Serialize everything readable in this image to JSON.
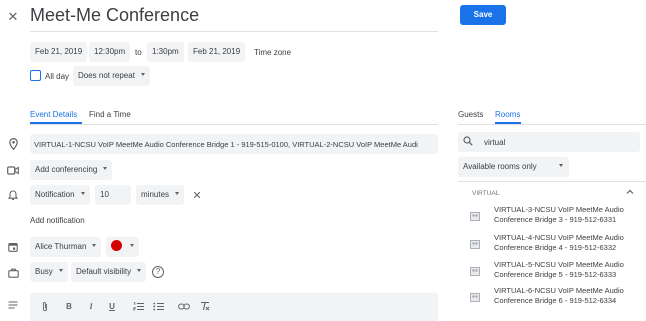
{
  "header": {
    "title": "Meet-Me Conference",
    "save_label": "Save"
  },
  "datetime": {
    "start_date": "Feb 21, 2019",
    "start_time": "12:30pm",
    "to_label": "to",
    "end_time": "1:30pm",
    "end_date": "Feb 21, 2019",
    "timezone_label": "Time zone",
    "allday_label": "All day",
    "repeat_value": "Does not repeat"
  },
  "tabs": {
    "event_details": "Event Details",
    "find_time": "Find a Time"
  },
  "details": {
    "location_value": "VIRTUAL-1-NCSU VoIP MeetMe Audio Conference Bridge 1 - 919-515-0100, VIRTUAL-2-NCSU VoIP MeetMe Audi",
    "conferencing_label": "Add conferencing",
    "notification_type": "Notification",
    "notification_amount": "10",
    "notification_unit": "minutes",
    "add_notification": "Add notification",
    "calendar_owner": "Alice Thurman",
    "busy_value": "Busy",
    "visibility_value": "Default visibility",
    "help_symbol": "?"
  },
  "side": {
    "tab_guests": "Guests",
    "tab_rooms": "Rooms",
    "search_value": "virtual",
    "filter_value": "Available rooms only",
    "section_label": "VIRTUAL",
    "rooms": [
      {
        "line1": "VIRTUAL-3-NCSU VoIP MeetMe Audio",
        "line2": "Conference Bridge 3 - 919-512-6331"
      },
      {
        "line1": "VIRTUAL-4-NCSU VoIP MeetMe Audio",
        "line2": "Conference Bridge 4 - 919-512-6332"
      },
      {
        "line1": "VIRTUAL-5-NCSU VoIP MeetMe Audio",
        "line2": "Conference Bridge 5 - 919-512-6333"
      },
      {
        "line1": "VIRTUAL-6-NCSU VoIP MeetMe Audio",
        "line2": "Conference Bridge 6 - 919-512-6334"
      }
    ]
  },
  "toolbar": {
    "bold": "B",
    "italic": "I",
    "underline": "U"
  },
  "colors": {
    "accent": "#1a73e8",
    "event_color": "#d50000"
  },
  "icons": [
    "close-icon",
    "location-icon",
    "video-icon",
    "bell-icon",
    "calendar-icon",
    "briefcase-icon",
    "notes-icon",
    "search-icon",
    "chevron-up-icon",
    "room-icon",
    "help-icon"
  ]
}
